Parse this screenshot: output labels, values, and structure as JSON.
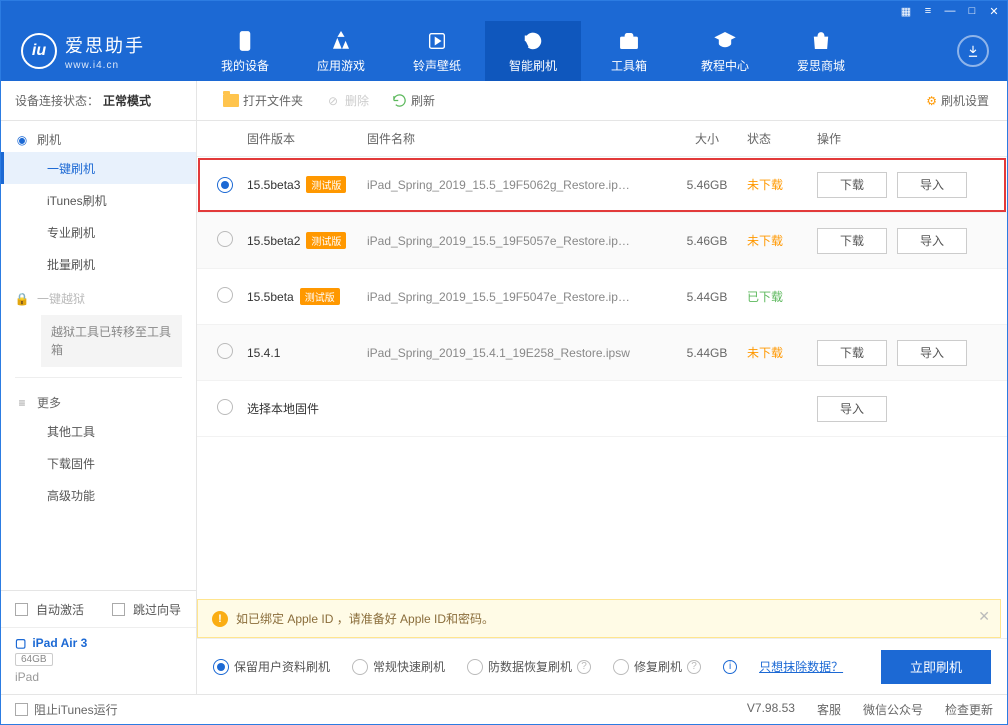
{
  "titlebar_icons": [
    "grid-icon",
    "list-icon",
    "minimize-icon",
    "maximize-icon",
    "close-icon"
  ],
  "logo": {
    "title": "爱思助手",
    "sub": "www.i4.cn"
  },
  "nav": [
    {
      "key": "device",
      "label": "我的设备"
    },
    {
      "key": "apps",
      "label": "应用游戏"
    },
    {
      "key": "ringtone",
      "label": "铃声壁纸"
    },
    {
      "key": "flash",
      "label": "智能刷机",
      "active": true
    },
    {
      "key": "toolbox",
      "label": "工具箱"
    },
    {
      "key": "tutorial",
      "label": "教程中心"
    },
    {
      "key": "mall",
      "label": "爱思商城"
    }
  ],
  "toolbar": {
    "open": "打开文件夹",
    "delete": "删除",
    "refresh": "刷新",
    "settings": "刷机设置"
  },
  "conn_status": {
    "label": "设备连接状态：",
    "value": "正常模式"
  },
  "sidebar": {
    "flash_group": "刷机",
    "flash_items": [
      "一键刷机",
      "iTunes刷机",
      "专业刷机",
      "批量刷机"
    ],
    "jailbreak_group": "一键越狱",
    "jailbreak_note": "越狱工具已转移至工具箱",
    "more_group": "更多",
    "more_items": [
      "其他工具",
      "下载固件",
      "高级功能"
    ],
    "auto_activate": "自动激活",
    "skip_guide": "跳过向导"
  },
  "device": {
    "name": "iPad Air 3",
    "capacity": "64GB",
    "type": "iPad"
  },
  "columns": {
    "version": "固件版本",
    "name": "固件名称",
    "size": "大小",
    "status": "状态",
    "ops": "操作"
  },
  "beta_tag": "测试版",
  "rows": [
    {
      "selected": true,
      "version": "15.5beta3",
      "beta": true,
      "name": "iPad_Spring_2019_15.5_19F5062g_Restore.ip…",
      "size": "5.46GB",
      "status": "未下载",
      "status_code": "not",
      "ops": [
        "下载",
        "导入"
      ],
      "highlight": true
    },
    {
      "selected": false,
      "version": "15.5beta2",
      "beta": true,
      "name": "iPad_Spring_2019_15.5_19F5057e_Restore.ip…",
      "size": "5.46GB",
      "status": "未下载",
      "status_code": "not",
      "ops": [
        "下载",
        "导入"
      ]
    },
    {
      "selected": false,
      "version": "15.5beta",
      "beta": true,
      "name": "iPad_Spring_2019_15.5_19F5047e_Restore.ip…",
      "size": "5.44GB",
      "status": "已下载",
      "status_code": "done",
      "ops": []
    },
    {
      "selected": false,
      "version": "15.4.1",
      "beta": false,
      "name": "iPad_Spring_2019_15.4.1_19E258_Restore.ipsw",
      "size": "5.44GB",
      "status": "未下载",
      "status_code": "not",
      "ops": [
        "下载",
        "导入"
      ]
    },
    {
      "selected": false,
      "version": "选择本地固件",
      "beta": false,
      "name": "",
      "size": "",
      "status": "",
      "status_code": "",
      "ops": [
        "导入"
      ],
      "local": true
    }
  ],
  "warning": "如已绑定 Apple ID ，请准备好 Apple ID和密码。",
  "flash_opts": [
    {
      "label": "保留用户资料刷机",
      "selected": true,
      "help": false
    },
    {
      "label": "常规快速刷机",
      "selected": false,
      "help": false
    },
    {
      "label": "防数据恢复刷机",
      "selected": false,
      "help": true
    },
    {
      "label": "修复刷机",
      "selected": false,
      "help": true
    }
  ],
  "erase_link": "只想抹除数据？",
  "flash_button": "立即刷机",
  "statusbar": {
    "block_itunes": "阻止iTunes运行",
    "version": "V7.98.53",
    "service": "客服",
    "wechat": "微信公众号",
    "update": "检查更新"
  }
}
